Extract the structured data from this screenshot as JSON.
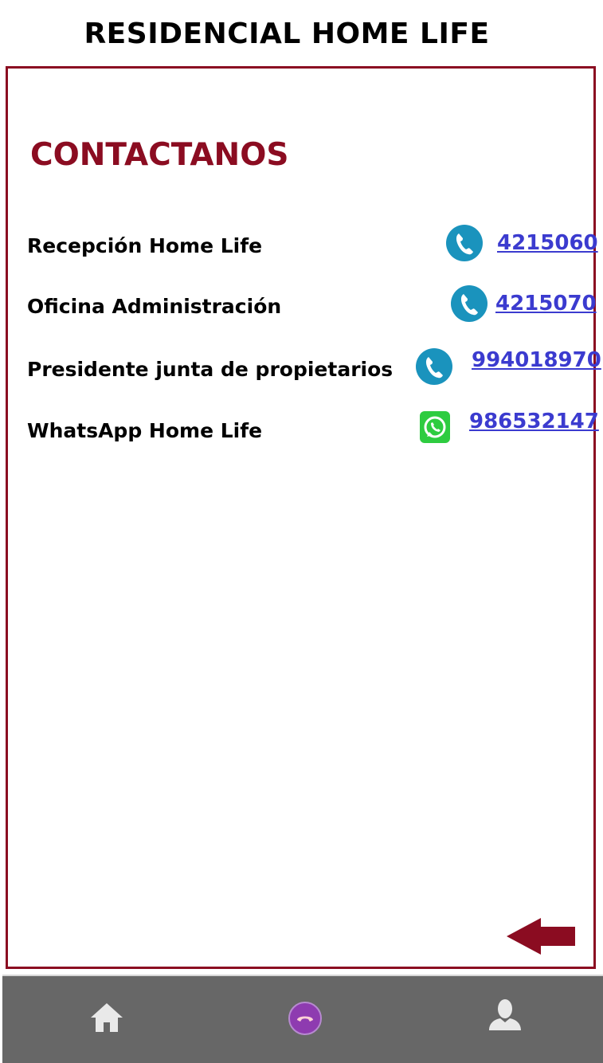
{
  "app": {
    "title": "RESIDENCIAL HOME LIFE"
  },
  "section": {
    "title": "CONTACTANOS"
  },
  "contacts": [
    {
      "label": "Recepción Home Life",
      "number": "4215060",
      "icon": "phone-icon"
    },
    {
      "label": "Oficina Administración",
      "number": "4215070",
      "icon": "phone-icon"
    },
    {
      "label": "Presidente junta de propietarios",
      "number": "994018970",
      "icon": "phone-icon"
    },
    {
      "label": "WhatsApp Home Life",
      "number": "986532147",
      "icon": "whatsapp-icon"
    }
  ],
  "nav": {
    "items": [
      "home-icon",
      "call-icon",
      "user-icon"
    ]
  },
  "colors": {
    "accent": "#8b0c21",
    "link": "#3b3bcf",
    "phone_icon": "#1a93bd",
    "whatsapp": "#2ecc40",
    "bottom_bar": "#676767",
    "call_button": "#8e3bb0"
  }
}
